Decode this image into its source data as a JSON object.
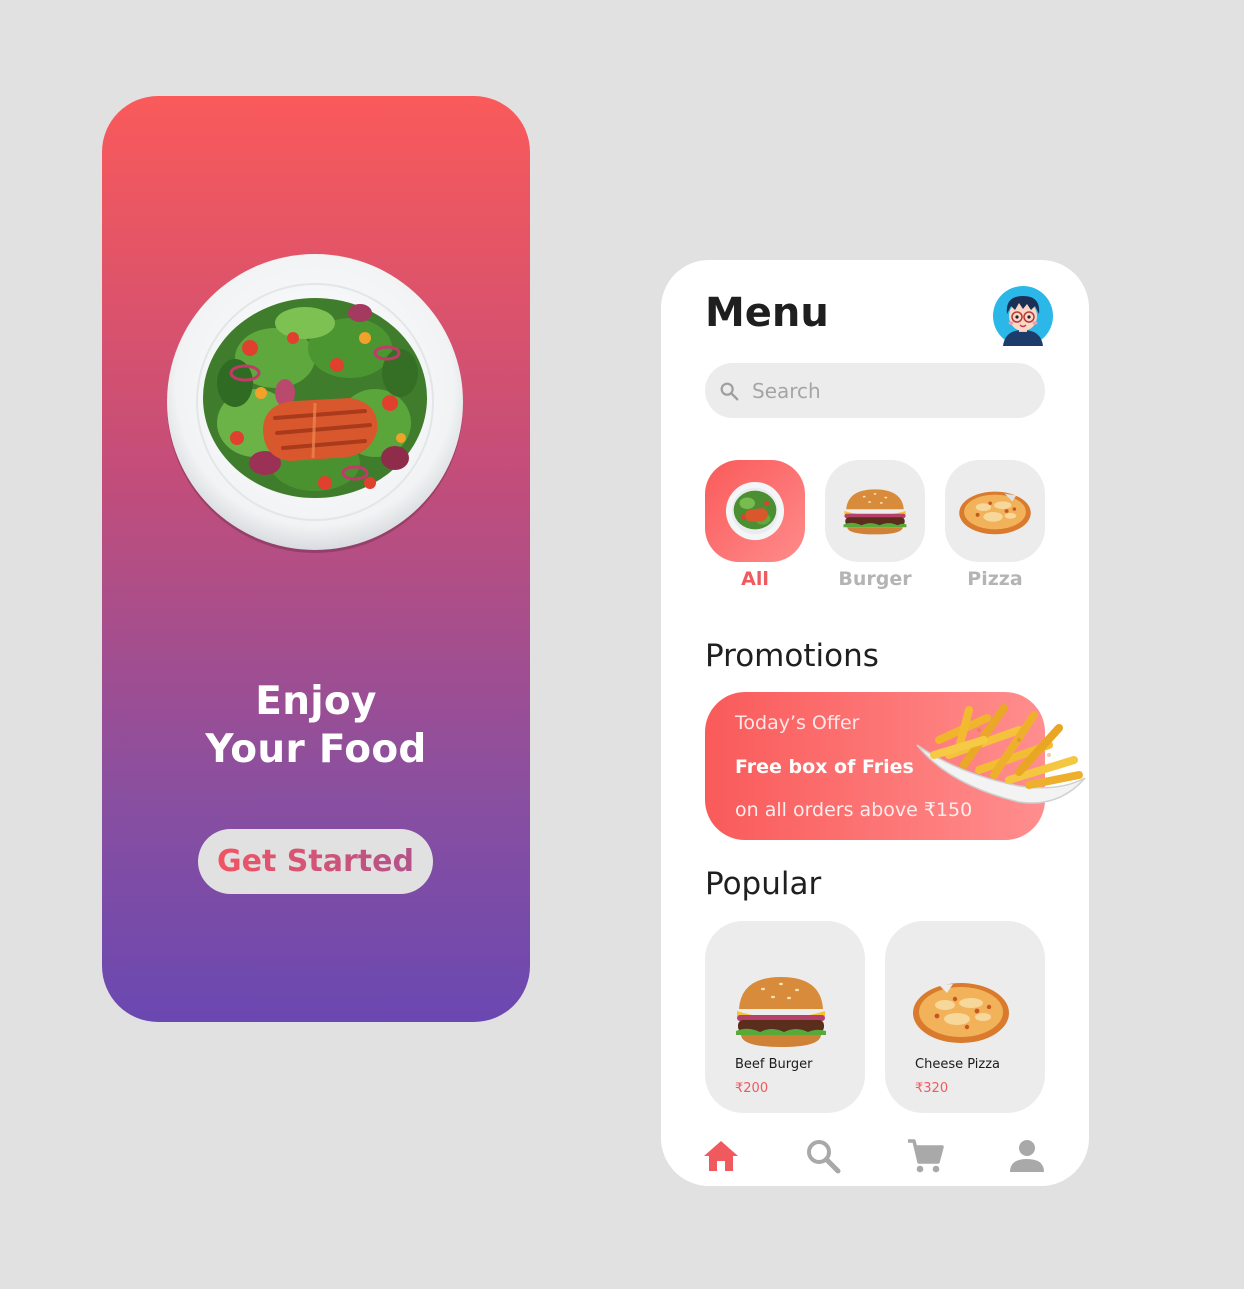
{
  "onboarding": {
    "headline_line1": "Enjoy",
    "headline_line2": "Your Food",
    "cta_label": "Get Started",
    "gradient": [
      "#fa5a5a",
      "#6a48b1"
    ]
  },
  "menu": {
    "title": "Menu",
    "avatar_icon": "avatar-boy-glasses",
    "search": {
      "placeholder": "Search",
      "icon": "search-icon"
    },
    "categories": [
      {
        "label": "All",
        "icon": "salad-plate",
        "active": true
      },
      {
        "label": "Burger",
        "icon": "burger",
        "active": false
      },
      {
        "label": "Pizza",
        "icon": "pizza",
        "active": false
      }
    ],
    "promotions": {
      "title": "Promotions",
      "line1": "Today’s Offer",
      "line2": "Free box of Fries",
      "line3": "on all orders above ₹150",
      "image_icon": "fries"
    },
    "popular": {
      "title": "Popular",
      "items": [
        {
          "name": "Beef Burger",
          "price": "₹200",
          "icon": "burger"
        },
        {
          "name": "Cheese Pizza",
          "price": "₹320",
          "icon": "pizza"
        }
      ]
    },
    "bottom_nav": [
      {
        "icon": "home-icon",
        "active": true
      },
      {
        "icon": "search-icon",
        "active": false
      },
      {
        "icon": "cart-icon",
        "active": false
      },
      {
        "icon": "profile-icon",
        "active": false
      }
    ],
    "colors": {
      "accent": "#f05a5f",
      "muted": "#b4b4b4",
      "tile": "#ececec"
    }
  }
}
